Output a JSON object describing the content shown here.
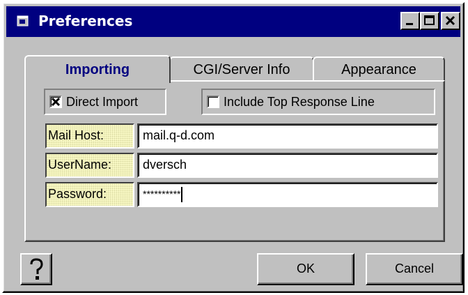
{
  "window": {
    "title": "Preferences",
    "icon": "app-window-icon"
  },
  "title_buttons": {
    "minimize_icon": "minimize-icon",
    "maximize_icon": "maximize-icon",
    "close_icon": "close-icon"
  },
  "tabs": [
    {
      "label": "Importing",
      "active": true
    },
    {
      "label": "CGI/Server Info",
      "active": false
    },
    {
      "label": "Appearance",
      "active": false
    }
  ],
  "options": {
    "direct_import": {
      "label": "Direct Import",
      "checked": true
    },
    "include_top_response": {
      "label": "Include Top Response Line",
      "checked": false
    }
  },
  "fields": {
    "mail_host": {
      "label": "Mail Host:",
      "value": "mail.q-d.com"
    },
    "username": {
      "label": "UserName:",
      "value": "dversch"
    },
    "password": {
      "label": "Password:",
      "value": "**********"
    }
  },
  "buttons": {
    "help_icon": "help-icon",
    "ok": "OK",
    "cancel": "Cancel"
  },
  "colors": {
    "titlebar": "#000080",
    "face": "#c0c0c0",
    "active_tab_text": "#000080",
    "label_bg": "#ffffcc"
  }
}
